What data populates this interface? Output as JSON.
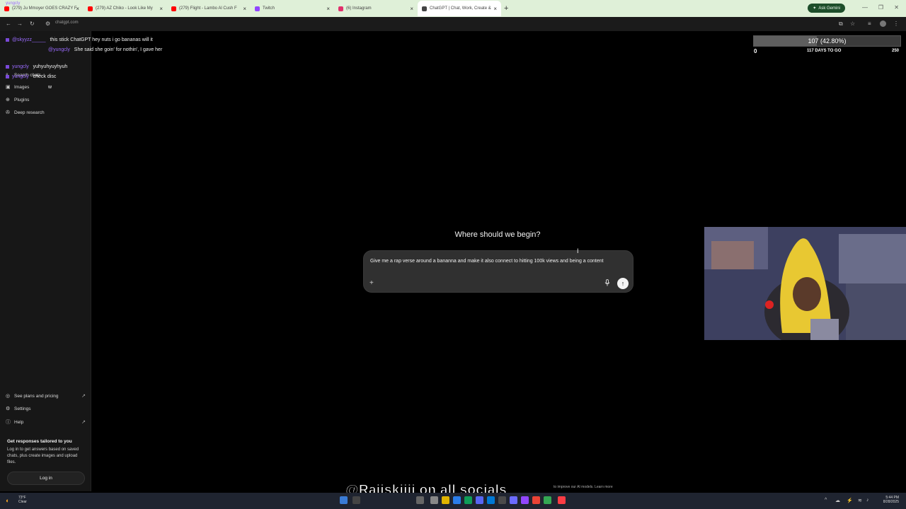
{
  "browser": {
    "tabs": [
      {
        "title": "(279) Ju Mmoyer GOES CRAZY F",
        "favicon_color": "#ff0000"
      },
      {
        "title": "(279) AZ Chiko - Look Like My",
        "favicon_color": "#ff0000"
      },
      {
        "title": "(279) Flight - Lambo Al Cush F",
        "favicon_color": "#ff0000"
      },
      {
        "title": "Twitch",
        "favicon_color": "#9146ff"
      },
      {
        "title": "(6) Instagram",
        "favicon_color": "#e1306c"
      },
      {
        "title": "ChatGPT | Chat, Work, Create &",
        "favicon_color": "#444444",
        "active": true
      }
    ],
    "new_tab": "+",
    "ask_gemini": "Ask Gemini",
    "url": "chatgpt.com"
  },
  "sidebar": {
    "search_chats": "Search chats",
    "images": "Images",
    "plugins": "Plugins",
    "deep_research": "Deep research",
    "see_plans": "See plans and pricing",
    "settings": "Settings",
    "help": "Help",
    "tailored_title": "Get responses tailored to you",
    "tailored_body": "Log in to get answers based on saved chats, plus create images and upload files.",
    "login": "Log in"
  },
  "chat_overlay": [
    {
      "user": "@skyyzz_____",
      "text": "this stick ChatGPT hey nuts i go bananas will it"
    },
    {
      "user": "@yungcly",
      "text": "She said she goin' for nothin', I gave her"
    },
    {
      "user": "yungcly",
      "text": "yuhyuhyuyhyuh"
    },
    {
      "user": "yungcly",
      "text": "check disc"
    },
    {
      "user": "",
      "text": "w"
    }
  ],
  "chat_overlay_header": "yungcly",
  "goal": {
    "progress_label": "107 (42.80%)",
    "progress_fraction": 0.428,
    "min": "0",
    "days": "117 DAYS TO GO",
    "max": "250"
  },
  "main": {
    "heading": "Where should we begin?",
    "prompt_text": "Give me a rap verse around a bananna and make it also connect to hitting 100k views and being a content",
    "plus_icon": "+",
    "send_icon": "↑"
  },
  "footer": {
    "watermark": "@Raiiskiiii on all socials",
    "disclaimer": "to improve our AI models. Learn more"
  },
  "taskbar": {
    "weather_temp": "73°F",
    "weather_desc": "Clear",
    "time": "5:44 PM",
    "date": "8/28/2025"
  }
}
